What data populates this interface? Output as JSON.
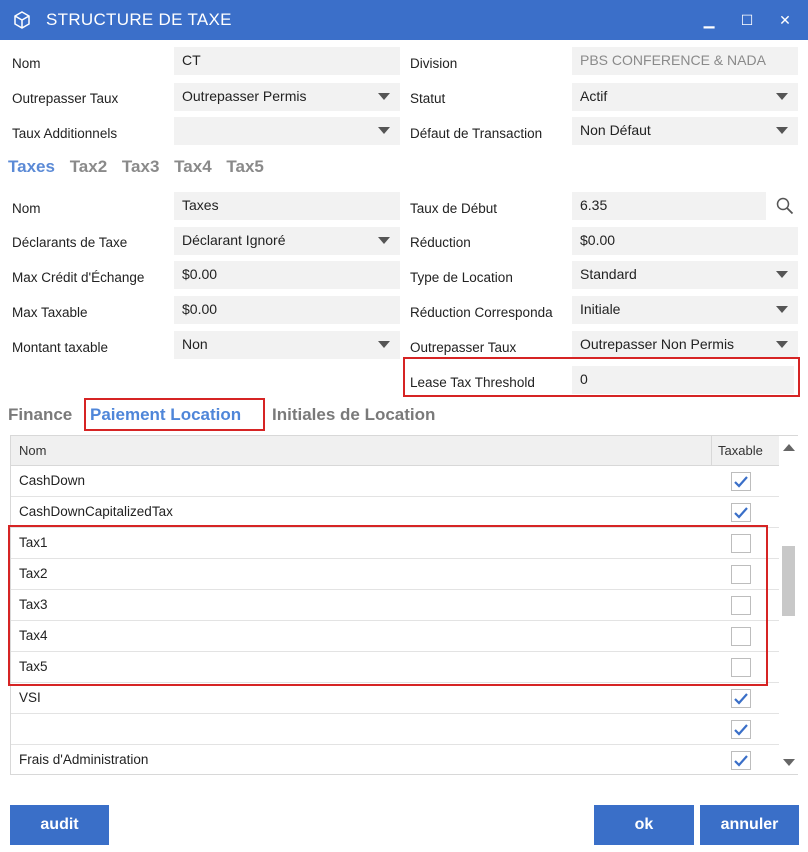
{
  "window": {
    "title": "STRUCTURE DE TAXE",
    "minimize_glyph": "▁",
    "maximize_glyph": "☐",
    "close_glyph": "✕"
  },
  "header_fields": {
    "nom_label": "Nom",
    "nom_value": "CT",
    "division_label": "Division",
    "division_value": "PBS CONFERENCE & NADA",
    "outrepasser_label": "Outrepasser Taux",
    "outrepasser_value": "Outrepasser Permis",
    "statut_label": "Statut",
    "statut_value": "Actif",
    "taux_add_label": "Taux Additionnels",
    "taux_add_value": "",
    "defaut_label": "Défaut de Transaction",
    "defaut_value": "Non Défaut"
  },
  "tax_tabs": [
    "Taxes",
    "Tax2",
    "Tax3",
    "Tax4",
    "Tax5"
  ],
  "tax_fields": {
    "nom_label": "Nom",
    "nom_value": "Taxes",
    "taux_debut_label": "Taux de Début",
    "taux_debut_value": "6.35",
    "declarants_label": "Déclarants de Taxe",
    "declarants_value": "Déclarant Ignoré",
    "reduction_label": "Réduction",
    "reduction_value": "$0.00",
    "max_credit_label": "Max Crédit d'Échange",
    "max_credit_value": "$0.00",
    "type_location_label": "Type de Location",
    "type_location_value": "Standard",
    "max_taxable_label": "Max Taxable",
    "max_taxable_value": "$0.00",
    "reduction_corr_label": "Réduction Corresponda",
    "reduction_corr_value": "Initiale",
    "montant_label": "Montant taxable",
    "montant_value": "Non",
    "outrepasser2_label": "Outrepasser Taux",
    "outrepasser2_value": "Outrepasser Non Permis",
    "lease_label": "Lease Tax Threshold",
    "lease_value": "0"
  },
  "section_tabs": {
    "finance": "Finance",
    "paiement": "Paiement Location",
    "initiales": "Initiales de Location"
  },
  "grid": {
    "col_nom": "Nom",
    "col_taxable": "Taxable",
    "rows": [
      {
        "name": "CashDown",
        "checked": true
      },
      {
        "name": "CashDownCapitalizedTax",
        "checked": true
      },
      {
        "name": "Tax1",
        "checked": false
      },
      {
        "name": "Tax2",
        "checked": false
      },
      {
        "name": "Tax3",
        "checked": false
      },
      {
        "name": "Tax4",
        "checked": false
      },
      {
        "name": "Tax5",
        "checked": false
      },
      {
        "name": "VSI",
        "checked": true
      },
      {
        "name": "",
        "checked": true
      },
      {
        "name": "Frais d'Administration",
        "checked": true
      }
    ]
  },
  "buttons": {
    "audit": "audit",
    "ok": "ok",
    "annuler": "annuler"
  },
  "colors": {
    "accent": "#3b6fc9",
    "highlight": "#d62424",
    "check": "#3a6fc8"
  }
}
